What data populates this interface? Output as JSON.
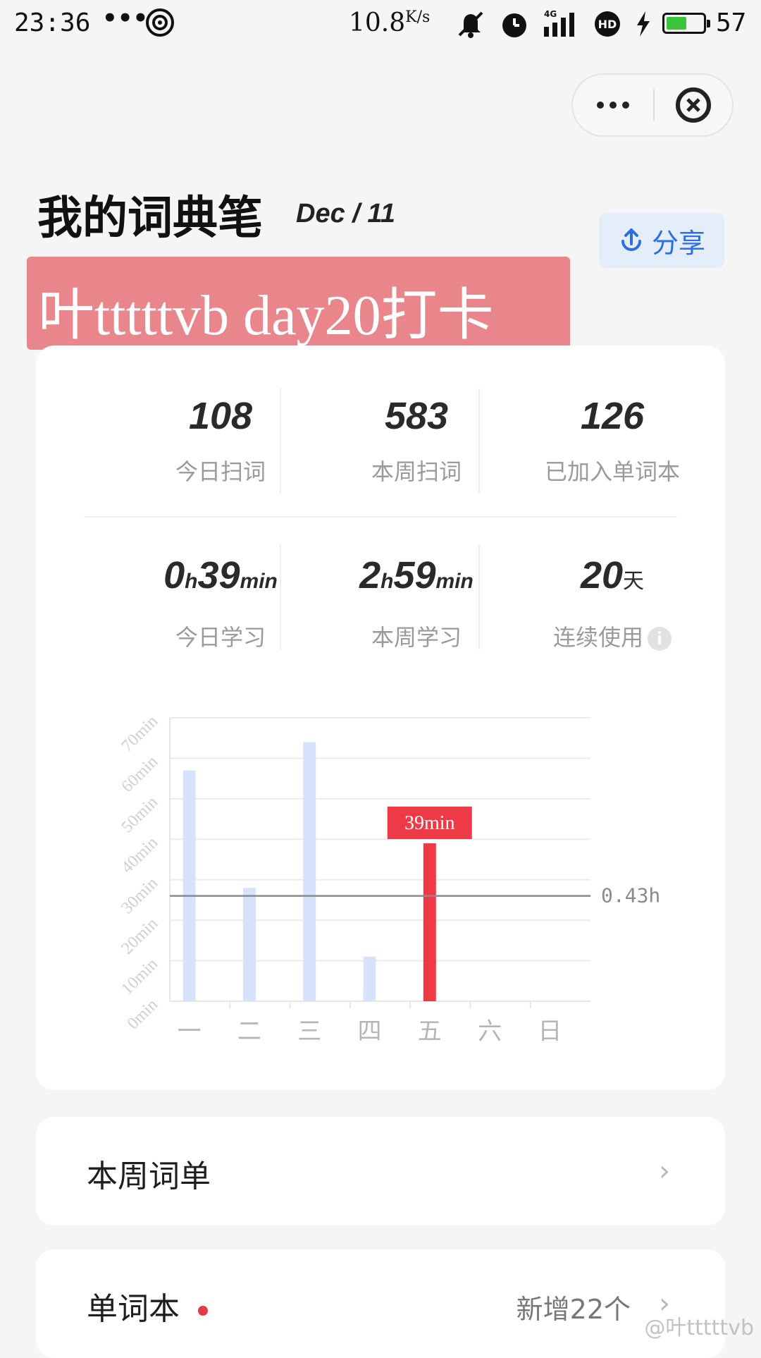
{
  "status_bar": {
    "time": "23:36",
    "dots": "•••",
    "speed_value": "10.8",
    "speed_unit": "K/s",
    "network": "4G",
    "battery": "57",
    "battery_level": 0.57,
    "battery_color": "#3bc43b"
  },
  "header": {
    "title": "我的词典笔",
    "date": "Dec / 11",
    "share_label": "分享",
    "accent": "#2d6fe0"
  },
  "banner": {
    "text": "叶tttttvb day20打卡",
    "color": "#e8868c"
  },
  "stats": [
    {
      "value": "108",
      "label": "今日扫词"
    },
    {
      "value": "583",
      "label": "本周扫词"
    },
    {
      "value": "126",
      "label": "已加入单词本"
    }
  ],
  "study": {
    "today": {
      "h": "0",
      "h_unit": "h",
      "m": "39",
      "m_unit": "min",
      "label": "今日学习"
    },
    "week": {
      "h": "2",
      "h_unit": "h",
      "m": "59",
      "m_unit": "min",
      "label": "本周学习"
    },
    "streak": {
      "value": "20",
      "unit": "天",
      "label": "连续使用"
    }
  },
  "chart_data": {
    "type": "bar",
    "categories": [
      "一",
      "二",
      "三",
      "四",
      "五",
      "六",
      "日"
    ],
    "values": [
      57,
      28,
      64,
      11,
      39,
      0,
      0
    ],
    "highlight_index": 4,
    "highlight_label": "39min",
    "average_line": {
      "value": 26,
      "label": "0.43h"
    },
    "yticks": [
      "0min",
      "10min",
      "20min",
      "30min",
      "40min",
      "50min",
      "60min",
      "70min"
    ],
    "ylim": [
      0,
      70
    ],
    "grid": true,
    "colors": {
      "bar": "#d7e3fb",
      "highlight": "#ee3a46",
      "avg_line": "#8a8a8a"
    }
  },
  "lists": {
    "week_words": {
      "title": "本周词单",
      "chevron": "›"
    },
    "wordbook": {
      "title": "单词本",
      "extra": "新增22个",
      "chevron": "›"
    }
  },
  "watermark": "@叶tttttvb"
}
